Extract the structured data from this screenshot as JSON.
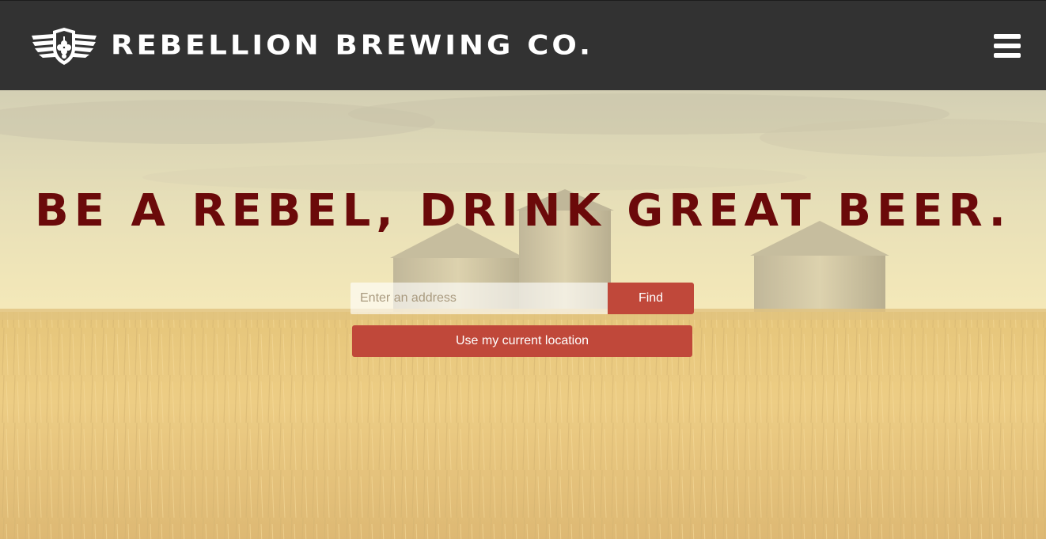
{
  "header": {
    "brand_name": "REBELLION BREWING CO.",
    "logo_icon": "hop-shield-wings-logo",
    "menu_icon": "hamburger-menu-icon",
    "background_color": "#323232"
  },
  "hero": {
    "headline": "BE A REBEL, DRINK GREAT BEER.",
    "headline_color": "#6b0a0a",
    "background_image": "wheat-field-grain-bins-photo"
  },
  "search": {
    "placeholder": "Enter an address",
    "value": "",
    "find_label": "Find",
    "location_label": "Use my current location",
    "button_color": "#c0483a"
  }
}
